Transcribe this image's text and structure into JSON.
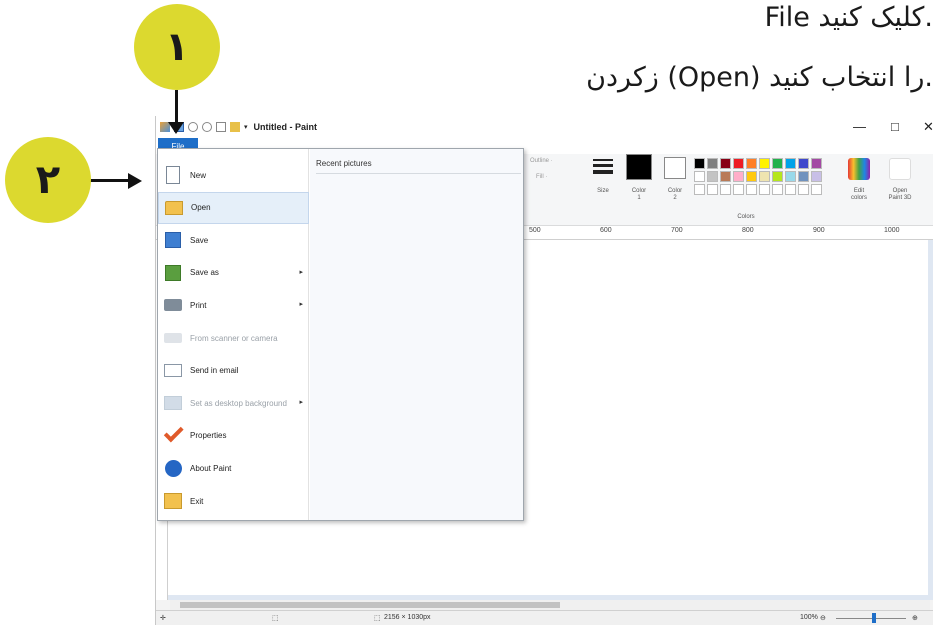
{
  "instructions": {
    "line1": "File کلیک کنید.",
    "line2": "زکردن (Open) را انتخاب کنید."
  },
  "callouts": {
    "step1": "۱",
    "step2": "۲"
  },
  "window": {
    "title": "Untitled - Paint",
    "file_tab": "File",
    "minimize": "—",
    "maximize": "□",
    "close": "✕"
  },
  "ribbon": {
    "outline_label": "Outline ·",
    "fill_label": "Fill ·",
    "size_label": "Size",
    "color1_label": "Color\n1",
    "color2_label": "Color\n2",
    "colors_group": "Colors",
    "edit_colors": "Edit\ncolors",
    "open_paint3d": "Open\nPaint 3D",
    "color1_value": "#000000",
    "color2_value": "#ffffff",
    "palette": [
      "#000000",
      "#7f7f7f",
      "#880015",
      "#ed1c24",
      "#ff7f27",
      "#fff200",
      "#22b14c",
      "#00a2e8",
      "#3f48cc",
      "#a349a4",
      "#ffffff",
      "#c3c3c3",
      "#b97a57",
      "#ffaec9",
      "#ffc90e",
      "#efe4b0",
      "#b5e61d",
      "#99d9ea",
      "#7092be",
      "#c8bfe7",
      "#ffffff",
      "#ffffff",
      "#ffffff",
      "#ffffff",
      "#ffffff",
      "#ffffff",
      "#ffffff",
      "#ffffff",
      "#ffffff",
      "#ffffff"
    ]
  },
  "ruler": {
    "ticks": [
      "500",
      "600",
      "700",
      "800",
      "900",
      "1000"
    ]
  },
  "file_menu": {
    "items": [
      {
        "label": "New",
        "icon": "new-file-icon",
        "disabled": false,
        "submenu": false
      },
      {
        "label": "Open",
        "icon": "open-folder-icon",
        "disabled": false,
        "submenu": false
      },
      {
        "label": "Save",
        "icon": "save-icon",
        "disabled": false,
        "submenu": false
      },
      {
        "label": "Save as",
        "icon": "save-as-icon",
        "disabled": false,
        "submenu": true
      },
      {
        "label": "Print",
        "icon": "printer-icon",
        "disabled": false,
        "submenu": true
      },
      {
        "label": "From scanner or camera",
        "icon": "scanner-icon",
        "disabled": true,
        "submenu": false
      },
      {
        "label": "Send in email",
        "icon": "email-icon",
        "disabled": false,
        "submenu": false
      },
      {
        "label": "Set as desktop background",
        "icon": "desktop-background-icon",
        "disabled": true,
        "submenu": true
      },
      {
        "label": "Properties",
        "icon": "checkmark-icon",
        "disabled": false,
        "submenu": false
      },
      {
        "label": "About Paint",
        "icon": "info-icon",
        "disabled": false,
        "submenu": false
      },
      {
        "label": "Exit",
        "icon": "exit-icon",
        "disabled": false,
        "submenu": false
      }
    ],
    "selected": "Open",
    "recent_title": "Recent pictures"
  },
  "status": {
    "dimensions": "2156 × 1030px",
    "zoom": "100%"
  }
}
